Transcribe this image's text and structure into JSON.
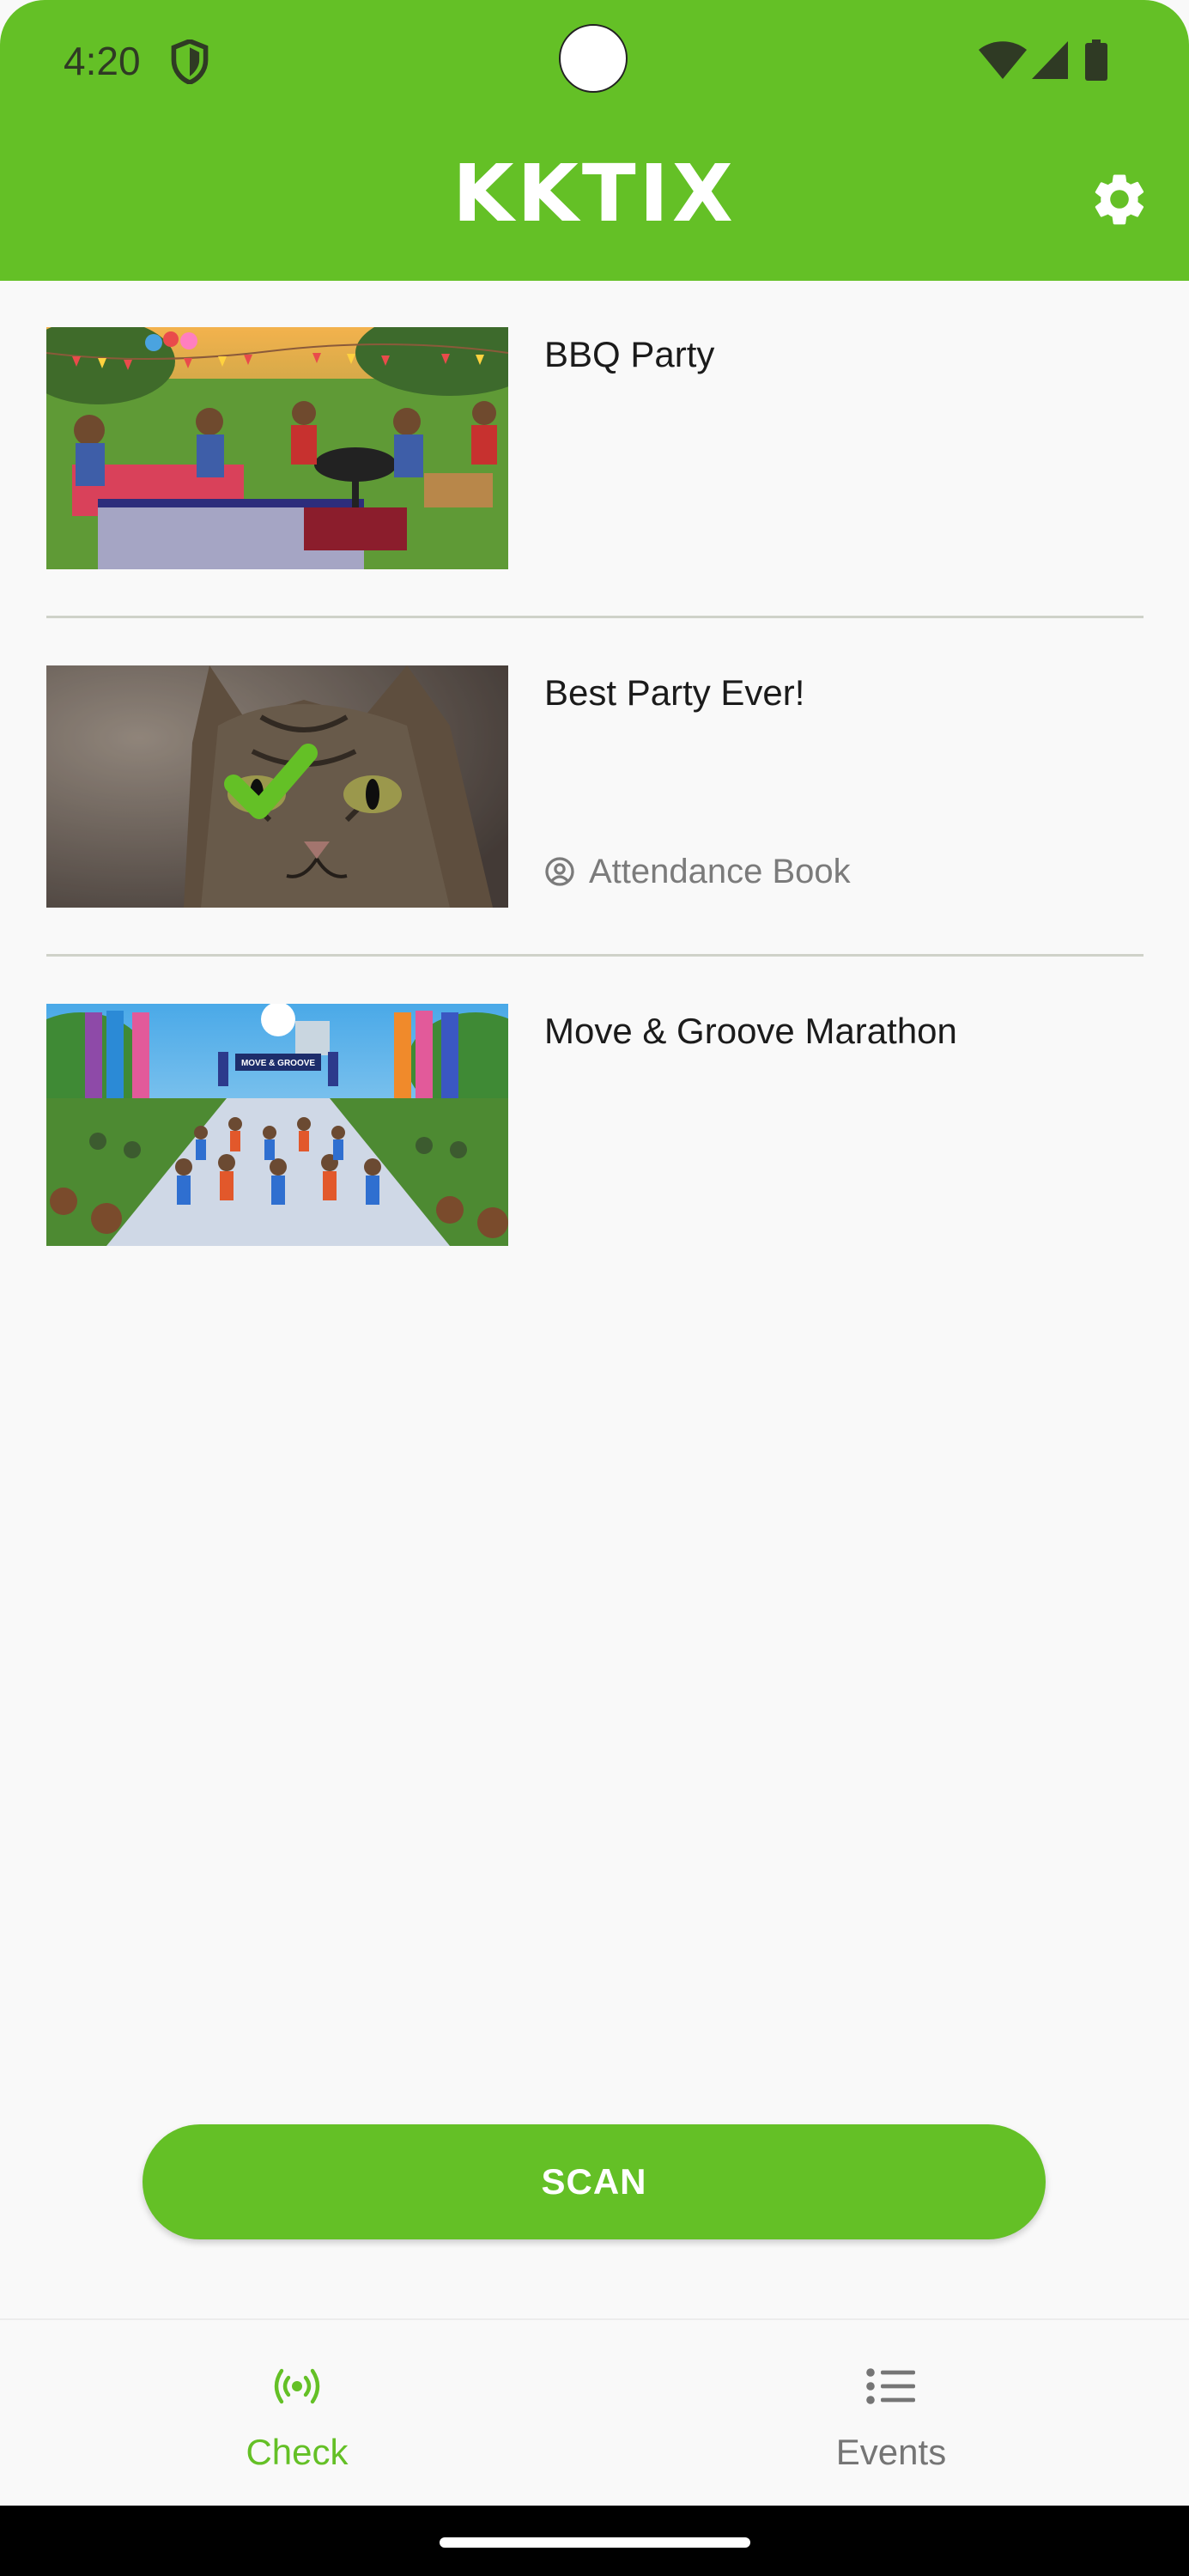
{
  "status_bar": {
    "time": "4:20"
  },
  "header": {
    "brand": "KKTIX"
  },
  "events": [
    {
      "title": "BBQ Party"
    },
    {
      "title": "Best Party Ever!",
      "tag": "Attendance Book"
    },
    {
      "title": "Move & Groove Marathon",
      "banner_text": "MOVE & GROOVE"
    }
  ],
  "scan": {
    "label": "SCAN"
  },
  "nav": {
    "tabs": [
      {
        "label": "Check",
        "icon": "radio-broadcast-icon",
        "active": true
      },
      {
        "label": "Events",
        "icon": "list-icon",
        "active": false
      }
    ]
  },
  "colors": {
    "accent": "#64c026",
    "text": "#1b1b1b",
    "muted": "#7b7b7b"
  }
}
